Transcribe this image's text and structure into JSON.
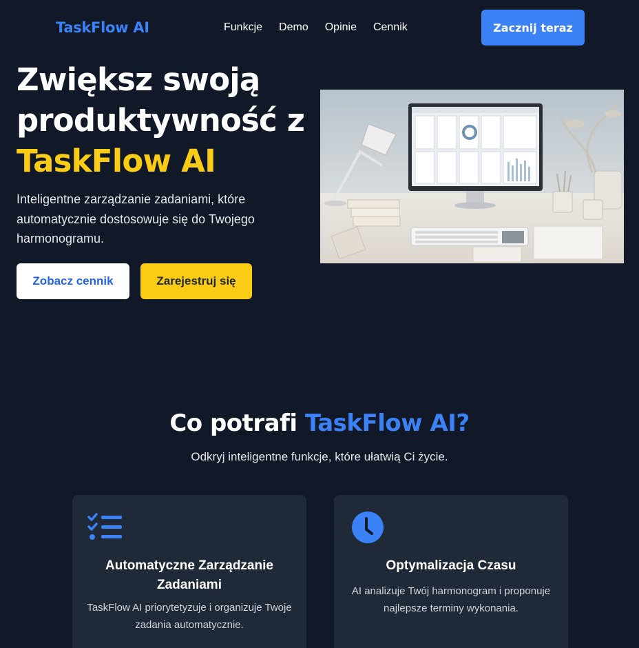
{
  "nav": {
    "logo": "TaskFlow AI",
    "links": [
      "Funkcje",
      "Demo",
      "Opinie",
      "Cennik"
    ],
    "cta": "Zacznij teraz"
  },
  "hero": {
    "title_line1": "Zwiększ swoją",
    "title_line2": "produktywność z",
    "title_brand": "TaskFlow AI",
    "subtitle": "Inteligentne zarządzanie zadaniami, które automatycznie dostosowuje się do Twojego harmonogramu.",
    "btn_pricing": "Zobacz cennik",
    "btn_register": "Zarejestruj się"
  },
  "features": {
    "title_prefix": "Co potrafi ",
    "title_brand": "TaskFlow AI?",
    "subtitle": "Odkryj inteligentne funkcje, które ułatwią Ci życie.",
    "cards": [
      {
        "icon": "checklist-icon",
        "title": "Automatyczne Zarządzanie Zadaniami",
        "text": "TaskFlow AI priorytetyzuje i organizuje Twoje zadania automatycznie."
      },
      {
        "icon": "clock-icon",
        "title": "Optymalizacja Czasu",
        "text": "AI analizuje Twój harmonogram i proponuje najlepsze terminy wykonania."
      }
    ]
  },
  "colors": {
    "background": "#111827",
    "accent_blue": "#3b82f6",
    "accent_yellow": "#facc15",
    "card": "#1f2937"
  }
}
